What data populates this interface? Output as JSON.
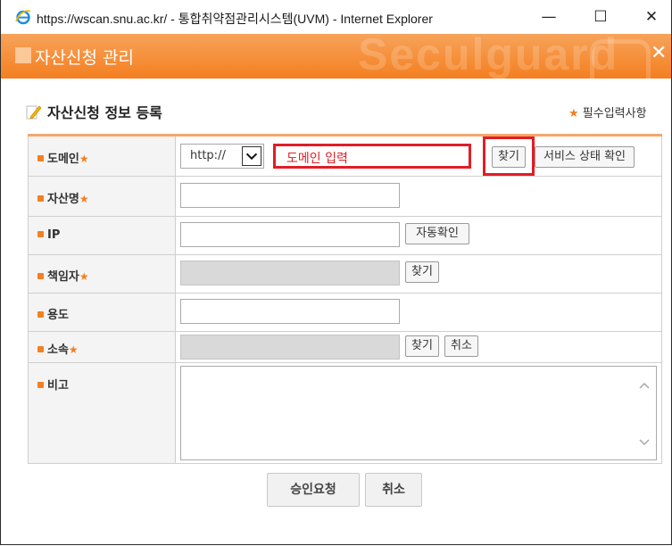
{
  "window": {
    "title": "https://wscan.snu.ac.kr/ - 통합취약점관리시스템(UVM) - Internet Explorer",
    "minimize": "—",
    "maximize": "☐",
    "close": "✕"
  },
  "header": {
    "title": "자산신청 관리",
    "watermark": "Seculguard",
    "close": "✕"
  },
  "section": {
    "title": "자산신청 정보 등록",
    "required_note": "필수입력사항",
    "star": "★"
  },
  "form": {
    "domain": {
      "label": "도메인",
      "protocol": "http://",
      "placeholder": "도메인 입력",
      "find_button": "찾기",
      "status_button": "서비스 상태 확인"
    },
    "asset_name": {
      "label": "자산명",
      "value": ""
    },
    "ip": {
      "label": "IP",
      "value": "",
      "auto_button": "자동확인"
    },
    "manager": {
      "label": "책임자",
      "value": "",
      "find_button": "찾기"
    },
    "purpose": {
      "label": "용도",
      "value": ""
    },
    "department": {
      "label": "소속",
      "value": "",
      "find_button": "찾기",
      "cancel_button": "취소"
    },
    "remarks": {
      "label": "비고",
      "value": ""
    }
  },
  "footer": {
    "request_button": "승인요청",
    "cancel_button": "취소"
  },
  "colors": {
    "accent": "#f47f20",
    "highlight": "#e01e25"
  }
}
